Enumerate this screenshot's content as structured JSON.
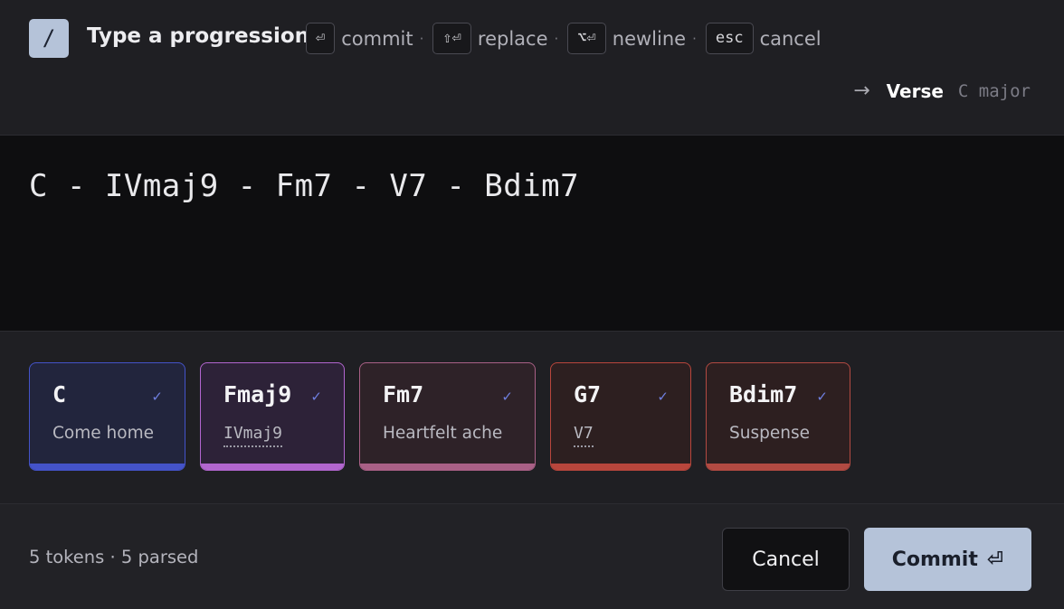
{
  "header": {
    "slash_key": "/",
    "title": "Type a progression",
    "hints": [
      {
        "key": "⏎",
        "label": "commit"
      },
      {
        "key": "⇧⏎",
        "label": "replace"
      },
      {
        "key": "⌥⏎",
        "label": "newline"
      },
      {
        "key": "esc",
        "label": "cancel"
      }
    ],
    "separator": "·",
    "target": {
      "arrow": "→",
      "section": "Verse",
      "key": "C major"
    }
  },
  "editor": {
    "text": "C - IVmaj9 - Fm7 - V7 - Bdim7"
  },
  "chips": [
    {
      "chord": "C",
      "check": "✓",
      "sub": "Come home",
      "sub_mono": false,
      "colors": {
        "border": "#4453c9",
        "bg": "#22253d",
        "bar": "#4453c9"
      }
    },
    {
      "chord": "Fmaj9",
      "check": "✓",
      "sub": "IVmaj9",
      "sub_mono": true,
      "colors": {
        "border": "#b266cf",
        "bg": "#2d2238",
        "bar": "#b266cf"
      }
    },
    {
      "chord": "Fm7",
      "check": "✓",
      "sub": "Heartfelt ache",
      "sub_mono": false,
      "colors": {
        "border": "#a96086",
        "bg": "#2e2228",
        "bar": "#a96086"
      }
    },
    {
      "chord": "G7",
      "check": "✓",
      "sub": "V7",
      "sub_mono": true,
      "colors": {
        "border": "#b8463c",
        "bg": "#2d1f20",
        "bar": "#b8463c"
      }
    },
    {
      "chord": "Bdim7",
      "check": "✓",
      "sub": "Suspense",
      "sub_mono": false,
      "colors": {
        "border": "#b24a42",
        "bg": "#2d1f20",
        "bar": "#b24a42"
      }
    }
  ],
  "footer": {
    "status": "5 tokens · 5 parsed",
    "cancel_label": "Cancel",
    "commit_label": "Commit",
    "commit_icon": "⏎"
  }
}
